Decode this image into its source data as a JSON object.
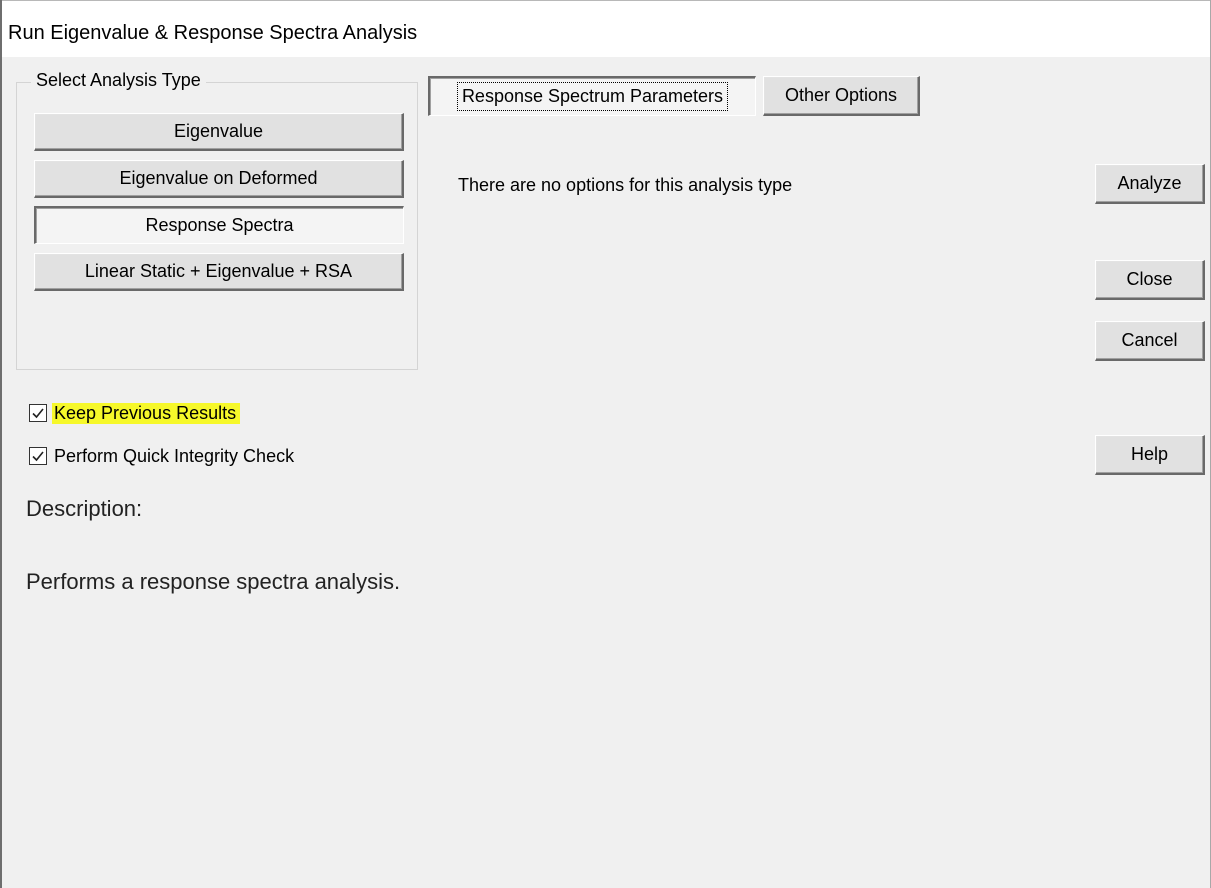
{
  "window": {
    "title": "Run Eigenvalue & Response Spectra Analysis"
  },
  "analysis_type": {
    "legend": "Select Analysis Type",
    "options": [
      {
        "label": "Eigenvalue",
        "selected": false
      },
      {
        "label": "Eigenvalue on Deformed",
        "selected": false
      },
      {
        "label": "Response Spectra",
        "selected": true
      },
      {
        "label": "Linear Static + Eigenvalue + RSA",
        "selected": false
      }
    ]
  },
  "tabs": [
    {
      "label": "Response Spectrum Parameters",
      "active": true
    },
    {
      "label": "Other Options",
      "active": false
    }
  ],
  "tab_content": {
    "message": "There are no options for this analysis type"
  },
  "actions": {
    "analyze": "Analyze",
    "close": "Close",
    "cancel": "Cancel",
    "help": "Help"
  },
  "checkboxes": [
    {
      "label": "Keep Previous Results",
      "checked": true,
      "highlighted": true,
      "highlight_color": "#f6f82a"
    },
    {
      "label": "Perform Quick Integrity Check",
      "checked": true,
      "highlighted": false
    }
  ],
  "description": {
    "title": "Description:",
    "text": "Performs a response spectra analysis."
  },
  "icons": {
    "checkbox": "checkmark-icon"
  }
}
